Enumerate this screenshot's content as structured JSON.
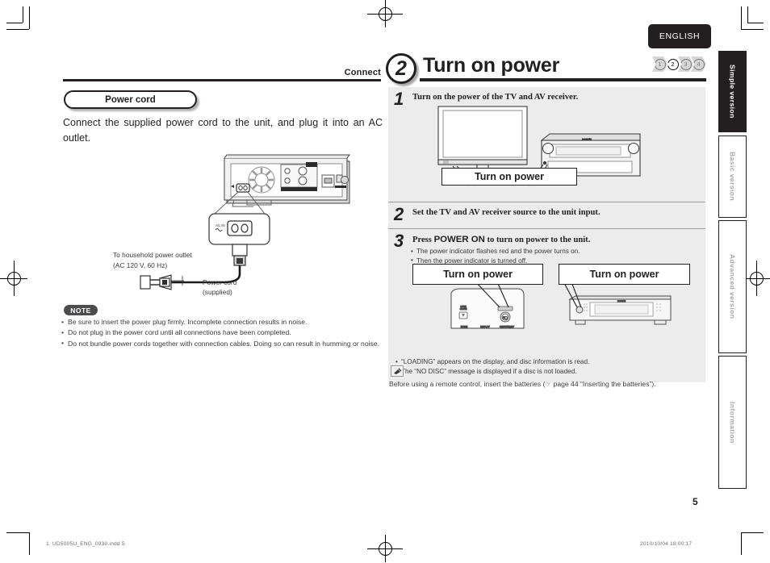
{
  "meta": {
    "language_tab": "ENGLISH",
    "page_number": "5",
    "footer_left": "1. UD5005U_ENG_0930.indd   5",
    "footer_right": "2010/10/04   18:00:17"
  },
  "steps_indicator": {
    "items": [
      "1",
      "2",
      "3",
      "4"
    ],
    "active_index": 1
  },
  "header": {
    "eyebrow": "Connect",
    "step_badge": "2",
    "title": "Turn on power"
  },
  "left": {
    "section_pill": "Power cord",
    "lead_text": "Connect the supplied power cord to the unit, and plug it into an AC outlet.",
    "diagram": {
      "ac_in_label": "AC IN",
      "outlet_caption_line1": "To household power outlet",
      "outlet_caption_line2": "(AC 120 V, 60 Hz)",
      "cord_caption_line1": "Power cord",
      "cord_caption_line2": "(supplied)"
    },
    "note": {
      "badge": "NOTE",
      "items": [
        "Be sure to insert the power plug firmly. Incomplete connection results in noise.",
        "Do not plug in the power cord until all connections have been completed.",
        "Do not bundle power cords together with connection cables. Doing so can result in humming or noise."
      ]
    }
  },
  "right": {
    "step1": {
      "number": "1",
      "title": "Turn on the power of the TV and AV receiver.",
      "callout": "Turn on power"
    },
    "step2": {
      "number": "2",
      "title": "Set the TV and AV receiver source to the unit input."
    },
    "step3": {
      "number": "3",
      "title_pre": "Press ",
      "title_key": "POWER ON",
      "title_post": " to turn on power to the unit.",
      "bullets": [
        "The power indicator flashes red and the power turns on.",
        "Then the power indicator is turned off."
      ],
      "callout_left": "Turn on power",
      "callout_right": "Turn on power",
      "footer_bullets": [
        "“LOADING” appears on the display, and disc information is read.",
        "The “NO DISC” message is displayed if a disc is not loaded."
      ]
    },
    "tip": {
      "icon": "remote-icon",
      "text": "Before using a remote control, insert the batteries (☞ page 44 “Inserting the batteries”)."
    }
  },
  "sidebar": {
    "tabs": [
      {
        "label": "Simple version",
        "active": true
      },
      {
        "label": "Basic version",
        "active": false
      },
      {
        "label": "Advanced version",
        "active": false
      },
      {
        "label": "Information",
        "active": false
      }
    ]
  }
}
